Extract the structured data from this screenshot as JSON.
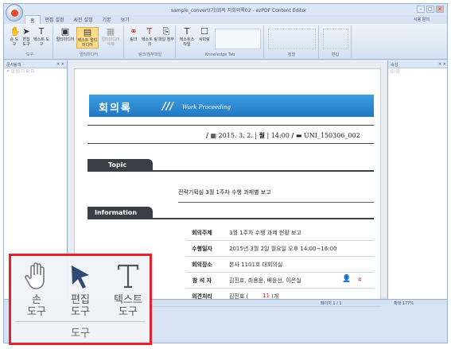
{
  "window": {
    "title": "sample_convert(기)회의 지회의록02 - ezPDF Content Editor",
    "help_label": "사용 문의"
  },
  "ribbon": {
    "tabs": [
      "홈",
      "편집 설정",
      "사진 설정",
      "기본",
      "보기"
    ],
    "groups": {
      "tools": "도구",
      "multimedia": "멀티미디어",
      "link": "링크/첨부파일",
      "knowledge": "Knowledge Tab",
      "layout": "정렬",
      "edit": "편집"
    },
    "buttons": {
      "hand": "손 도구",
      "select": "편집 도구",
      "text": "텍스트 도구",
      "multimedia": "멀티미디어",
      "text_multimedia": "텍스트 멀티미디어",
      "multimedia_delete": "멀티미디어 삭제",
      "link": "링크",
      "text_link": "텍스트 링크",
      "attach": "파일 첨부",
      "text_style": "텍스트스타일",
      "quiz": "사파랑"
    }
  },
  "left_pane": {
    "title": "문서탐색"
  },
  "right_pane": {
    "title": "속성"
  },
  "document": {
    "title": "회의록",
    "subtitle": "Work Proceeding",
    "date": "2015. 3. 2.",
    "weekday": "월",
    "time": "14:00",
    "doc_id": "UNI_150306_002",
    "topic_heading": "Topic",
    "topic_text": "전략기획실 3월 1주차 수행 과제별 보고",
    "info_heading": "Information",
    "info": [
      {
        "key": "회의주제",
        "value": "3월 1주차 수행 과제 현황 보고"
      },
      {
        "key": "수행일자",
        "value": "2015년 3월 2일 월요일 오후 14:00~16:00"
      },
      {
        "key": "회의장소",
        "value": "본사 1101호 대회의실"
      },
      {
        "key": "참 석 자",
        "value": "김진호, 최용윤, 배윤선, 이은실",
        "count": "4"
      },
      {
        "key": "의견처리",
        "value": "김진호 (",
        "count": "11",
        "suffix": ")개"
      }
    ]
  },
  "status": {
    "page": "페이지 1 / 1",
    "zoom": "확대 177%"
  },
  "callout": {
    "hand": [
      "손",
      "도구"
    ],
    "select": [
      "편집",
      "도구"
    ],
    "text": [
      "텍스트",
      "도구"
    ],
    "group_label": "도구"
  },
  "colors": {
    "banner": "#1f78c4",
    "highlight": "#e8202a",
    "section": "#3a3f47"
  }
}
